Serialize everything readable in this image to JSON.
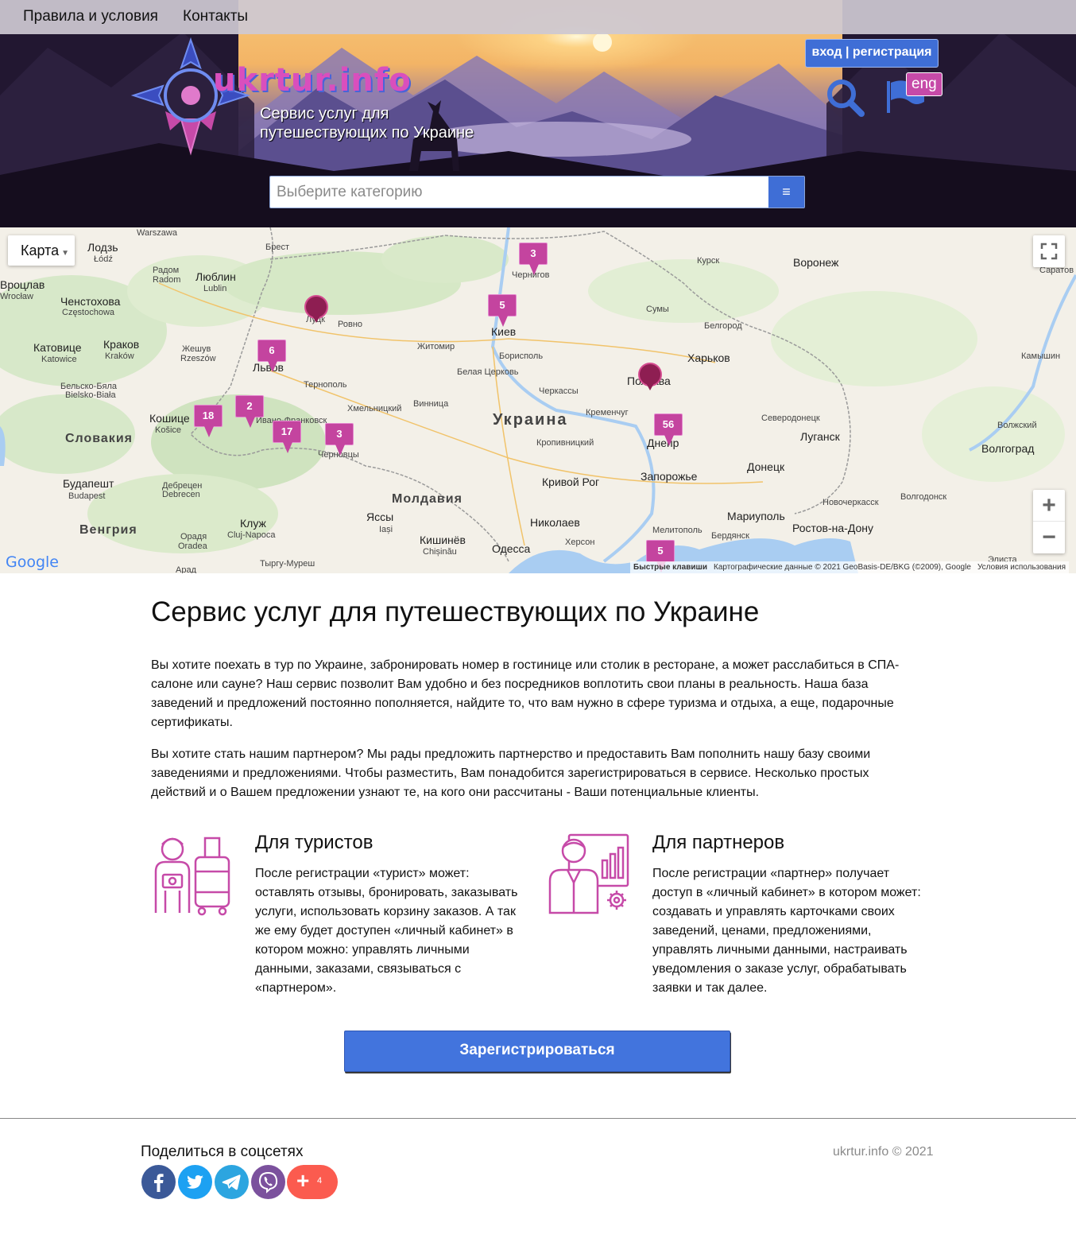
{
  "nav": {
    "terms": "Правила и условия",
    "contacts": "Контакты"
  },
  "header": {
    "logo_text": "ukrtur.info",
    "tagline": "Сервис услуг для путешествующих по Украине",
    "login_label": "вход | регистрация",
    "lang_label": "eng",
    "search_placeholder": "Выберите категорию",
    "search_button_icon": "≡"
  },
  "map": {
    "type_label": "Карта",
    "country_labels": [
      "Украина",
      "Словакия",
      "Венгрия",
      "Молдавия"
    ],
    "city_labels": [
      [
        "Warszawa",
        ""
      ],
      [
        "Лодзь",
        "Łódź"
      ],
      [
        "Брест",
        ""
      ],
      [
        "Радом",
        "Radom"
      ],
      [
        "Люблин",
        "Lublin"
      ],
      [
        "Вроцлав",
        "Wrocław"
      ],
      [
        "Ченстохова",
        "Częstochowa"
      ],
      [
        "Катовице",
        "Katowice"
      ],
      [
        "Краков",
        "Kraków"
      ],
      [
        "Жешув",
        "Rzeszów"
      ],
      [
        "Бельско-Бяла",
        "Bielsko-Biała"
      ],
      [
        "Ровно",
        ""
      ],
      [
        "Луцк",
        ""
      ],
      [
        "Львов",
        ""
      ],
      [
        "Тернополь",
        ""
      ],
      [
        "Хмельницкий",
        ""
      ],
      [
        "Житомир",
        ""
      ],
      [
        "Чернигов",
        ""
      ],
      [
        "Киев",
        ""
      ],
      [
        "Борисполь",
        ""
      ],
      [
        "Белая Церковь",
        ""
      ],
      [
        "Винница",
        ""
      ],
      [
        "Черкассы",
        ""
      ],
      [
        "Кременчуг",
        ""
      ],
      [
        "Кропивницкий",
        ""
      ],
      [
        "Полтава",
        ""
      ],
      [
        "Сумы",
        ""
      ],
      [
        "Курск",
        ""
      ],
      [
        "Воронеж",
        ""
      ],
      [
        "Белгород",
        ""
      ],
      [
        "Харьков",
        ""
      ],
      [
        "Камышин",
        ""
      ],
      [
        "Северодонецк",
        ""
      ],
      [
        "Луганск",
        ""
      ],
      [
        "Волжский",
        ""
      ],
      [
        "Волгоград",
        ""
      ],
      [
        "Днепр",
        ""
      ],
      [
        "Запорожье",
        ""
      ],
      [
        "Донецк",
        ""
      ],
      [
        "Кривой Рог",
        ""
      ],
      [
        "Николаев",
        ""
      ],
      [
        "Херсон",
        ""
      ],
      [
        "Одесса",
        ""
      ],
      [
        "Мелитополь",
        ""
      ],
      [
        "Бердянск",
        ""
      ],
      [
        "Мариуполь",
        ""
      ],
      [
        "Новочеркасск",
        ""
      ],
      [
        "Волгодонск",
        ""
      ],
      [
        "Ростов-на-Дону",
        ""
      ],
      [
        "Элиста",
        ""
      ],
      [
        "Кошице",
        "Košice"
      ],
      [
        "Ивано-Франковск",
        ""
      ],
      [
        "Черновцы",
        ""
      ],
      [
        "Будапешт",
        "Budapest"
      ],
      [
        "Дебрецен",
        "Debrecen"
      ],
      [
        "Клуж",
        "Cluj-Napoca"
      ],
      [
        "Орадя",
        "Oradea"
      ],
      [
        "Яссы",
        "Iași"
      ],
      [
        "Кишинёв",
        "Chișinău"
      ],
      [
        "Тыргу-Муреш",
        "Târgu Mureș"
      ],
      [
        "Арад",
        ""
      ],
      [
        "Саратов",
        ""
      ]
    ],
    "clusters": [
      "3",
      "5",
      "6",
      "2",
      "18",
      "17",
      "3",
      "56",
      "5"
    ],
    "google_logo": "Google",
    "shortcuts": "Быстрые клавиши",
    "data_credit": "Картографические данные © 2021 GeoBasis-DE/BKG (©2009), Google",
    "terms": "Условия использования"
  },
  "main": {
    "title": "Сервис услуг для путешествующих по Украине",
    "para1": "Вы хотите поехать в тур по Украине, забронировать номер в гостинице или столик в ресторане, а может расслабиться в СПА-салоне или сауне? Наш сервис позволит Вам удобно и без посредников воплотить свои планы в реальность. Наша база заведений и предложений постоянно пополняется, найдите то, что вам нужно в сфере туризма и отдыха, а еще, подарочные сертификаты.",
    "para2": "Вы хотите стать нашим партнером? Мы рады предложить партнерство и предоставить Вам пополнить нашу базу своими заведениями и предложениями. Чтобы разместить, Вам понадобится зарегистрироваться в сервисе. Несколько простых действий и о Вашем предложении узнают те, на кого они рассчитаны - Ваши потенциальные клиенты.",
    "tourists_title": "Для туристов",
    "tourists_text": "После регистрации «турист» может: оставлять отзывы, бронировать, заказывать услуги, использовать корзину заказов. А так же ему будет доступен «личный кабинет» в котором можно: управлять личными данными, заказами, связываться с «партнером».",
    "partners_title": "Для партнеров",
    "partners_text": "После регистрации «партнер» получает доступ в «личный кабинет» в котором может: создавать и управлять карточками своих заведений, ценами, предложениями, управлять личными данными, настраивать уведомления о заказе услуг, обрабатывать заявки и так далее.",
    "register_label": "Зарегистрироваться"
  },
  "footer": {
    "share_title": "Поделиться в соцсетях",
    "more_count": "4",
    "copyright": "ukrtur.info © 2021"
  },
  "colors": {
    "accent": "#c4449f",
    "primary": "#4274dd",
    "facebook": "#3b5998",
    "twitter": "#1da1f2",
    "telegram": "#2ca5e0",
    "viber": "#7b519d",
    "more": "#fb5b4f"
  },
  "icons": [
    "search-icon",
    "flag-icon",
    "menu-icon",
    "fullscreen-icon",
    "tourist-icon",
    "partner-icon",
    "facebook-icon",
    "twitter-icon",
    "telegram-icon",
    "viber-icon",
    "plus-icon"
  ]
}
